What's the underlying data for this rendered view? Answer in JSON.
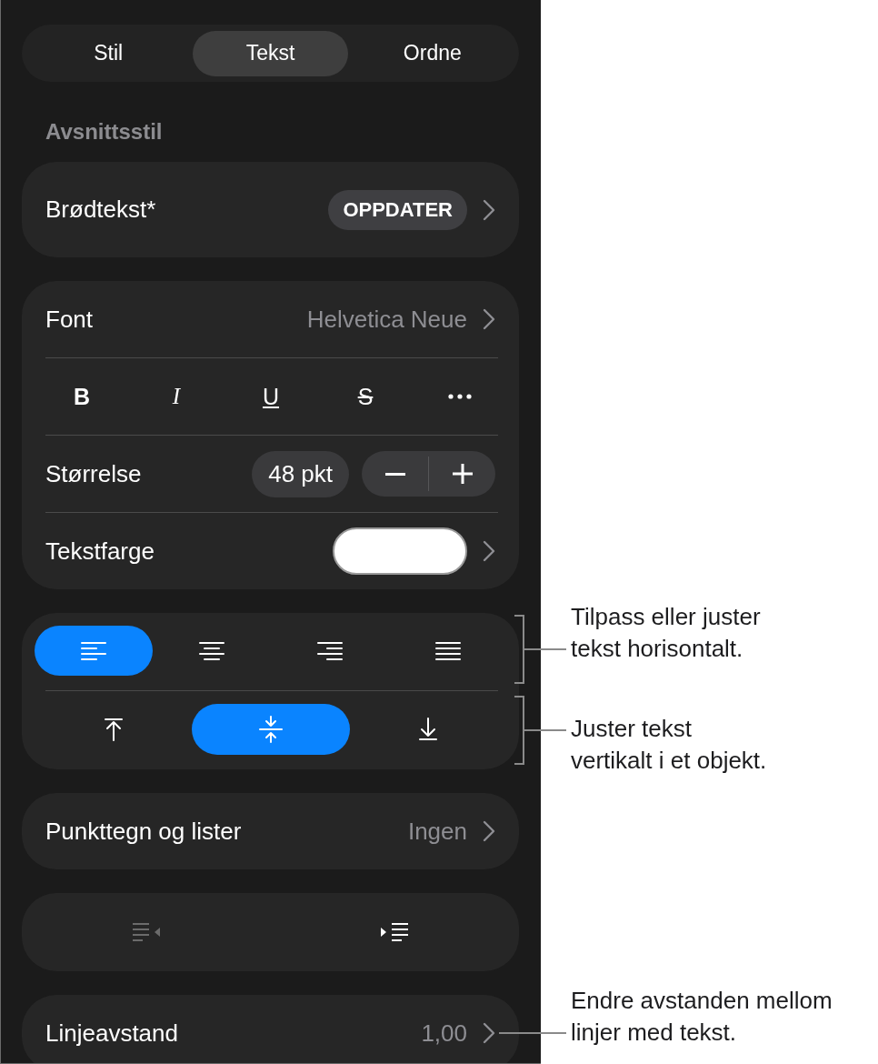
{
  "tabs": [
    {
      "label": "Stil",
      "selected": false
    },
    {
      "label": "Tekst",
      "selected": true
    },
    {
      "label": "Ordne",
      "selected": false
    }
  ],
  "paragraph_style": {
    "heading": "Avsnittsstil",
    "style_name": "Brødtekst*",
    "update_button": "OPPDATER"
  },
  "font_card": {
    "font_label": "Font",
    "font_value": "Helvetica Neue",
    "style_buttons": [
      {
        "kind": "bold",
        "label": "B",
        "on": false
      },
      {
        "kind": "italic",
        "label": "I",
        "on": false
      },
      {
        "kind": "underline",
        "label": "U",
        "on": false
      },
      {
        "kind": "strikethrough",
        "label": "S",
        "on": false
      },
      {
        "kind": "more"
      }
    ],
    "size_label": "Størrelse",
    "size_value": "48 pkt",
    "text_color": {
      "label": "Tekstfarge",
      "color": "#ffffff"
    }
  },
  "alignment": {
    "horizontal": [
      {
        "kind": "left",
        "selected": true
      },
      {
        "kind": "center",
        "selected": false
      },
      {
        "kind": "right",
        "selected": false
      },
      {
        "kind": "justify",
        "selected": false
      }
    ],
    "vertical": [
      {
        "kind": "top",
        "selected": false
      },
      {
        "kind": "middle",
        "selected": true
      },
      {
        "kind": "bottom",
        "selected": false
      }
    ]
  },
  "bullets": {
    "label": "Punkttegn og lister",
    "value": "Ingen"
  },
  "indent_buttons": [
    {
      "kind": "decrease",
      "disabled": true
    },
    {
      "kind": "increase",
      "disabled": false
    }
  ],
  "line_spacing": {
    "label": "Linjeavstand",
    "value": "1,00"
  },
  "callouts": [
    {
      "kind": "bracket",
      "lines": [
        "Tilpass eller juster",
        "tekst horisontalt."
      ]
    },
    {
      "kind": "bracket",
      "lines": [
        "Juster tekst",
        "vertikalt i et objekt."
      ]
    },
    {
      "kind": "leader",
      "lines": [
        "Endre avstanden mellom",
        "linjer med tekst."
      ]
    }
  ]
}
